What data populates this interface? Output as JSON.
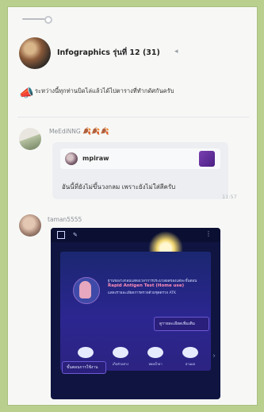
{
  "group": {
    "title": "Infographics รุ่นที่ 12",
    "count": "(31)"
  },
  "announcement": {
    "text": "ระหว่างนี้ทุกท่านบิดไล่แล้วได้ไปตารางที่ทำกดัศกันครับ"
  },
  "messages": [
    {
      "name": "MeEdiNNG",
      "quote_name": "mpiraw",
      "text": "อันนี้ที่ยังไม่ขึ้นวงกลม เพราะยังไม่ใส่สีครับ",
      "time": "11:57"
    },
    {
      "name": "taman5555"
    }
  ],
  "image": {
    "line1": "ฐานของวงกลมแสดงเวลาการประมวลผลของแต่ละขั้นตอน",
    "line2": "Rapid Antigen Test (Home use)",
    "line3": "แสดงรายละเอียดการตรวจด้วยชุดตรวจ ATK",
    "button1": "ดูรายละเอียดเพิ่มเติม",
    "steps": [
      "เตรียมอุปกรณ์",
      "เก็บตัวอย่าง",
      "หยดน้ำยา",
      "อ่านผล"
    ],
    "button2": "ขั้นตอนการใช้งาน"
  },
  "icons": {
    "speaker": "speaker-icon",
    "megaphone": "megaphone-icon",
    "leaf": "leaf-icon"
  },
  "colors": {
    "background": "#b9cf8e",
    "accent": "#2f6fd6"
  }
}
